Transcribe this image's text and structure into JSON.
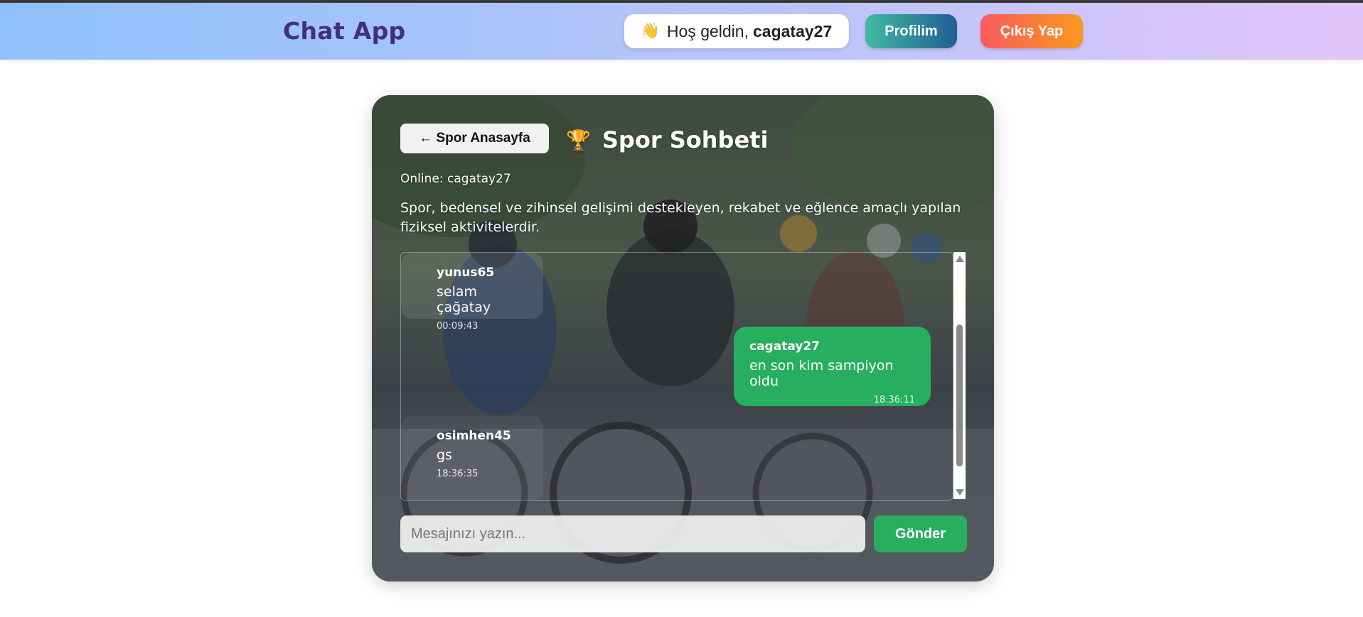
{
  "navbar": {
    "brand": "Chat App",
    "welcome_prefix": "Hoş geldin,",
    "username": "cagatay27",
    "profile_label": "Profilim",
    "logout_label": "Çıkış Yap",
    "wave_icon": "waving-hand-icon"
  },
  "room": {
    "back_label": "← Spor Anasayfa",
    "trophy_icon": "trophy-icon",
    "title": "Spor Sohbeti",
    "online_text": "Online: cagatay27",
    "description": "Spor, bedensel ve zihinsel gelişimi destekleyen, rekabet ve eğlence amaçlı yapılan fiziksel aktivitelerdir."
  },
  "messages": [
    {
      "user": "yunus65",
      "text": "selam çağatay",
      "time": "00:09:43",
      "own": false
    },
    {
      "user": "cagatay27",
      "text": "en son kim sampiyon oldu",
      "time": "18:36:11",
      "own": true
    },
    {
      "user": "osimhen45",
      "text": "gs",
      "time": "18:36:35",
      "own": false
    }
  ],
  "composer": {
    "placeholder": "Mesajınızı yazın...",
    "send_label": "Gönder"
  },
  "colors": {
    "brand": "#41307f",
    "own_bubble": "#27ae5f",
    "send_button": "#27ae5f"
  }
}
